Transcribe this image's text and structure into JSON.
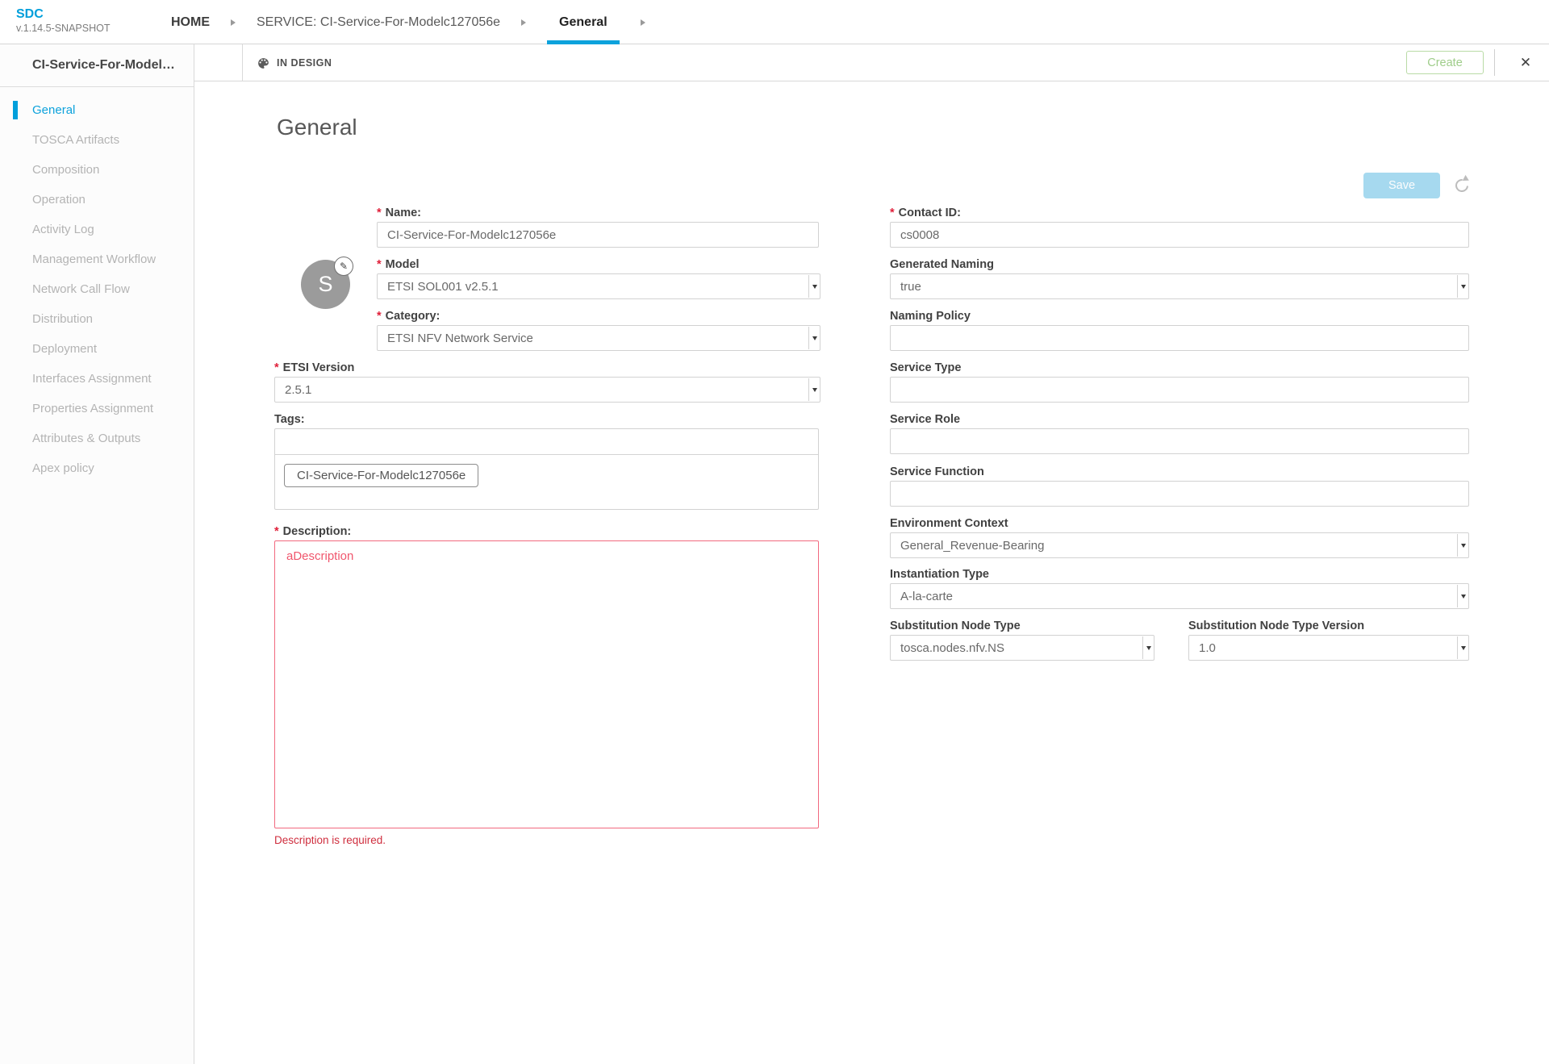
{
  "app": {
    "name": "SDC",
    "version": "v.1.14.5-SNAPSHOT"
  },
  "breadcrumbs": {
    "home": "HOME",
    "service": "SERVICE: CI-Service-For-Modelc127056e",
    "current": "General"
  },
  "header": {
    "status": "IN DESIGN",
    "create_label": "Create"
  },
  "panel": {
    "title": "CI-Service-For-Modelc...",
    "items": [
      {
        "label": "General",
        "active": true
      },
      {
        "label": "TOSCA Artifacts"
      },
      {
        "label": "Composition"
      },
      {
        "label": "Operation"
      },
      {
        "label": "Activity Log"
      },
      {
        "label": "Management Workflow"
      },
      {
        "label": "Network Call Flow"
      },
      {
        "label": "Distribution"
      },
      {
        "label": "Deployment"
      },
      {
        "label": "Interfaces Assignment"
      },
      {
        "label": "Properties Assignment"
      },
      {
        "label": "Attributes & Outputs"
      },
      {
        "label": "Apex policy"
      }
    ]
  },
  "main": {
    "heading": "General",
    "save_label": "Save",
    "avatar": {
      "letter": "S"
    }
  },
  "form": {
    "name": {
      "label": "Name:",
      "value": "CI-Service-For-Modelc127056e"
    },
    "model": {
      "label": "Model",
      "value": "ETSI SOL001 v2.5.1"
    },
    "category": {
      "label": "Category:",
      "value": "ETSI NFV Network Service"
    },
    "etsi_version": {
      "label": "ETSI Version",
      "value": "2.5.1"
    },
    "tags": {
      "label": "Tags:",
      "value": "",
      "chip": "CI-Service-For-Modelc127056e"
    },
    "description": {
      "label": "Description:",
      "value": "aDescription",
      "error": "Description is required."
    },
    "contact_id": {
      "label": "Contact ID:",
      "value": "cs0008"
    },
    "generated_naming": {
      "label": "Generated Naming",
      "value": "true"
    },
    "naming_policy": {
      "label": "Naming Policy",
      "value": ""
    },
    "service_type": {
      "label": "Service Type",
      "value": ""
    },
    "service_role": {
      "label": "Service Role",
      "value": ""
    },
    "service_function": {
      "label": "Service Function",
      "value": ""
    },
    "environment_context": {
      "label": "Environment Context",
      "value": "General_Revenue-Bearing"
    },
    "instantiation_type": {
      "label": "Instantiation Type",
      "value": "A-la-carte"
    },
    "substitution_node_type": {
      "label": "Substitution Node Type",
      "value": "tosca.nodes.nfv.NS"
    },
    "substitution_node_type_version": {
      "label": "Substitution Node Type Version",
      "value": "1.0"
    }
  },
  "icons": {
    "close": "✕",
    "edit": "✎",
    "required_marker": "*"
  },
  "colors": {
    "accent": "#009fdb",
    "error_text": "#cf2e3e",
    "error_border": "#f2697f",
    "error_value": "#f0566d",
    "save_disabled_bg": "#a6d9ef",
    "create_text": "#9fcd8a"
  }
}
